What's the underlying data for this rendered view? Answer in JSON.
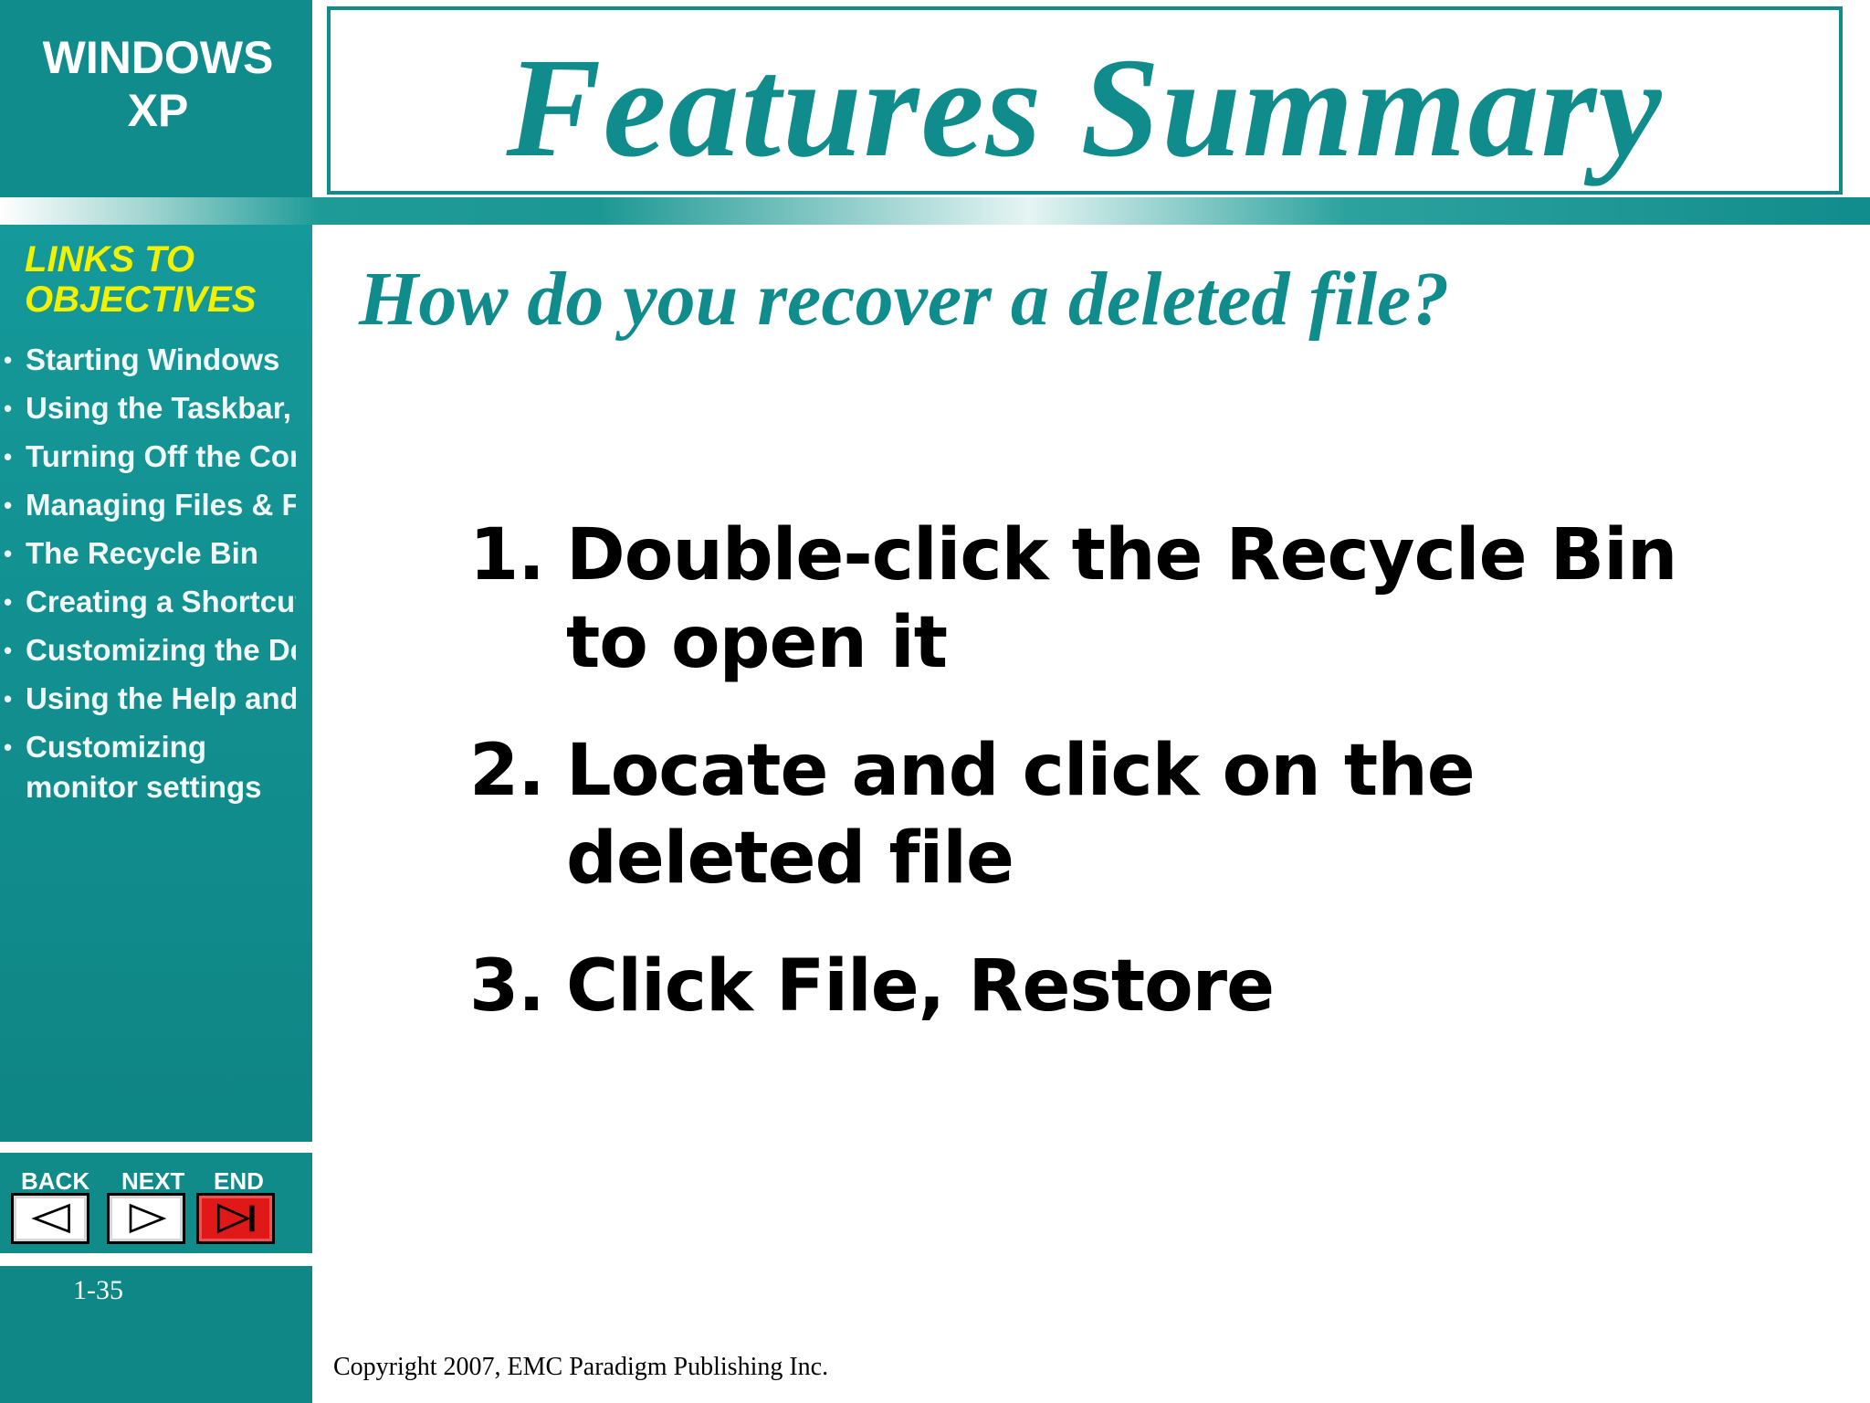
{
  "app": {
    "title_line1": "WINDOWS",
    "title_line2": "XP"
  },
  "slide": {
    "title": "Features Summary",
    "question": "How do you recover a deleted file?",
    "steps": [
      {
        "num": "1.",
        "text": "Double-click the Recycle Bin to open it"
      },
      {
        "num": "2.",
        "text": "Locate and click on the deleted file"
      },
      {
        "num": "3.",
        "text": "Click File, Restore"
      }
    ],
    "page_number": "1-35",
    "copyright": "Copyright 2007, EMC Paradigm Publishing Inc."
  },
  "sidebar": {
    "heading_line1": "LINKS TO",
    "heading_line2": "OBJECTIVES",
    "items": [
      {
        "label": "Starting Windows"
      },
      {
        "label": "Using the Taskbar, op"
      },
      {
        "label": "Turning Off the Comp"
      },
      {
        "label": "Managing Files & Fol"
      },
      {
        "label": "The Recycle Bin"
      },
      {
        "label": "Creating a Shortcut"
      },
      {
        "label": "Customizing the Des"
      },
      {
        "label": "Using the Help and S"
      },
      {
        "label": "Customizing monitor settings"
      }
    ]
  },
  "nav": {
    "back_label": "BACK",
    "next_label": "NEXT",
    "end_label": "END",
    "back_icon": "triangle-left-icon",
    "next_icon": "triangle-right-icon",
    "end_icon": "skip-to-end-icon"
  },
  "colors": {
    "teal": "#118c8c",
    "heading_yellow": "#f2f200",
    "end_red": "#e01818"
  }
}
